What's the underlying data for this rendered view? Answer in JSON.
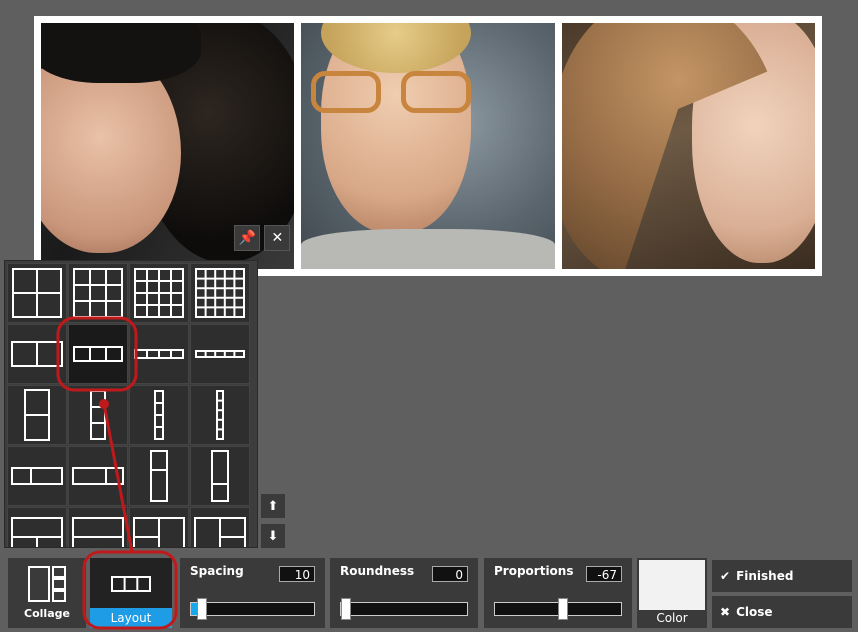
{
  "icons": {
    "pin": "pin-icon",
    "close": "close-icon",
    "up": "arrow-up-icon",
    "down": "arrow-down-icon",
    "check": "checkmark-icon",
    "x": "close-icon"
  },
  "glyphs": {
    "pin": "📌",
    "close": "✕",
    "up": "⬆",
    "down": "⬇",
    "check": "✔",
    "x": "✖"
  },
  "toolbar": {
    "collage_label": "Collage",
    "layout_label": "Layout",
    "spacing": {
      "label": "Spacing",
      "value": "10",
      "fraction": 0.05
    },
    "roundness": {
      "label": "Roundness",
      "value": "0",
      "fraction": 0.0
    },
    "proportions": {
      "label": "Proportions",
      "value": "-67",
      "fraction": 0.5
    },
    "color_label": "Color",
    "color_value": "#f2f2f2",
    "finished_label": "Finished",
    "close_label": "Close"
  },
  "colors": {
    "accent": "#1e9ce6",
    "annotation": "#c0191b"
  }
}
